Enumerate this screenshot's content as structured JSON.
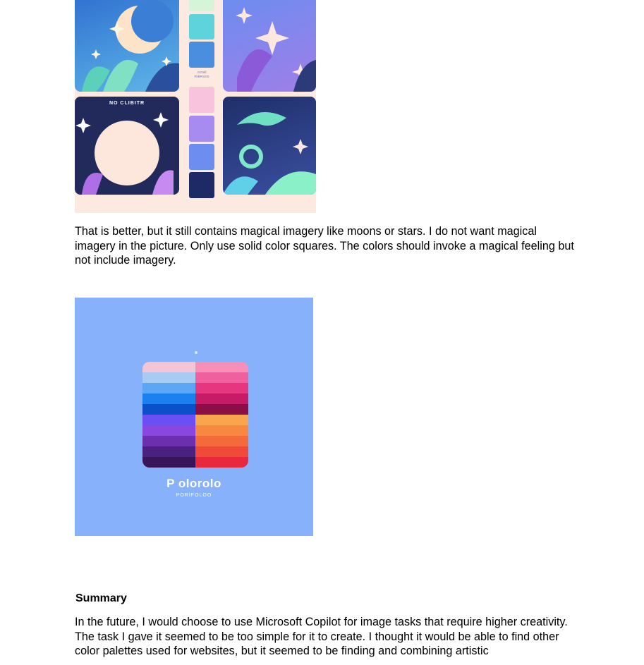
{
  "paragraph_1": "That is better, but it still contains magical imagery like moons or stars. I do not want magical imagery in the picture. Only use solid color squares. The colors should invoke a magical feeling but not include imagery.",
  "image_1": {
    "tile_text": "NO CLIBITR",
    "swatch_caption_1": "ᴊʟʏᴏᴇl",
    "swatch_caption_2": "ᴘᴏʀᴘᴏʟᴏᴏ",
    "swatch_colors": [
      "#d6f5d8",
      "#5fd3dc",
      "#4a8ee0",
      "#f8c3dc",
      "#a78bf0",
      "#6d8ef0",
      "#1e2a66"
    ]
  },
  "image_2": {
    "logo_title": "P olorolo",
    "logo_subtitle": "PORIFOLOO",
    "left_column_colors": [
      "#f3c5d6",
      "#a7cbf3",
      "#5ba6f5",
      "#1a82f0",
      "#0b4fc9",
      "#6a4ff2",
      "#8a46e0",
      "#6b2fb0",
      "#4a2080",
      "#38155a"
    ],
    "right_column_colors": [
      "#f690b8",
      "#f05f9e",
      "#e8357f",
      "#c61c68",
      "#8c0e47",
      "#f7a64e",
      "#f78840",
      "#f56a3a",
      "#f04b38",
      "#e8293d"
    ]
  },
  "summary_heading": "Summary",
  "paragraph_2": "In the future, I would choose to use Microsoft Copilot for image tasks that require higher creativity. The task I gave it seemed to be too simple for it to create. I thought it would be able to find other color palettes used for websites, but it seemed to be finding and combining artistic"
}
